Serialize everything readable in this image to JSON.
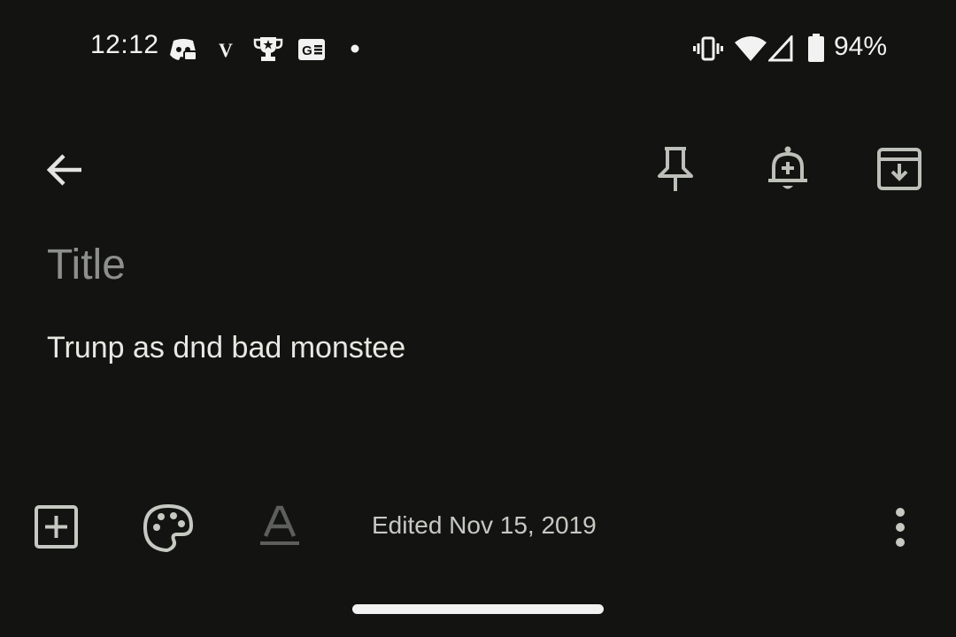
{
  "status_bar": {
    "time": "12:12",
    "battery_percent": "94%",
    "notification_icons": [
      "discord-icon",
      "v-app-icon",
      "trophy-icon",
      "game-icon",
      "dot-icon"
    ],
    "system_icons": [
      "vibrate-icon",
      "wifi-icon",
      "cell-signal-icon",
      "battery-icon"
    ]
  },
  "toolbar": {
    "back_icon": "arrow-left-icon",
    "pin_icon": "pin-icon",
    "reminder_icon": "bell-plus-icon",
    "archive_icon": "archive-icon"
  },
  "note": {
    "title_placeholder": "Title",
    "body": "Trunp as dnd bad monstee"
  },
  "bottom_bar": {
    "add_icon": "add-box-icon",
    "palette_icon": "palette-icon",
    "text_format_icon": "text-format-icon",
    "edited": "Edited Nov 15, 2019",
    "more_icon": "more-vertical-icon"
  },
  "colors": {
    "background": "#131411",
    "icon": "#c6c8c2",
    "placeholder": "#8d8f8a",
    "text": "#e8e8e3"
  }
}
